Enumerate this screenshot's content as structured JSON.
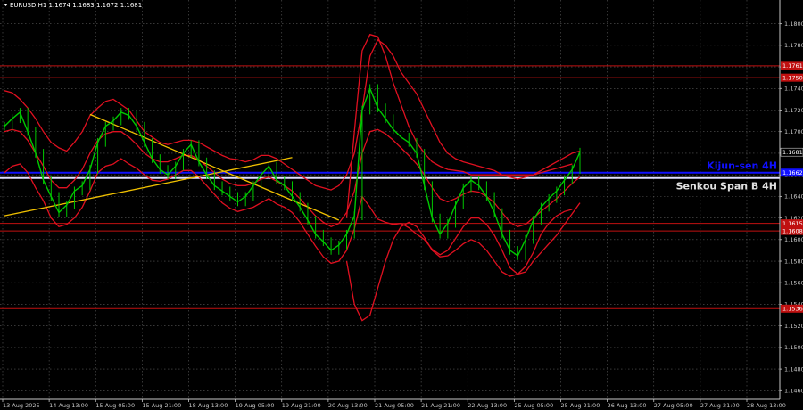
{
  "header": {
    "symbol_line": "EURUSD,H1  1.1674 1.1683 1.1672 1.1681"
  },
  "colors": {
    "background": "#000000",
    "grid": "#5a5a5a",
    "bull": "#00c800",
    "bear": "#00c800",
    "kumo": "#e01020",
    "trendline": "#f0c000",
    "level_red": "#c01010",
    "kijun": "#1010ff",
    "senkou": "#e0e0ff",
    "price_line": "#7a7a7a",
    "tick_text": "#c8c8c8"
  },
  "chart_data": {
    "type": "line",
    "title": "",
    "xlabel": "",
    "ylabel": "",
    "ylim": [
      1.1452,
      1.1822
    ],
    "y_ticks": [
      "1.1800",
      "1.1780",
      "1.1760",
      "1.1740",
      "1.1720",
      "1.1700",
      "1.1680",
      "1.1660",
      "1.1640",
      "1.1620",
      "1.1600",
      "1.1580",
      "1.1560",
      "1.1540",
      "1.1520",
      "1.1500",
      "1.1480",
      "1.1460"
    ],
    "x_ticks": [
      "13 Aug 2025",
      "14 Aug 13:00",
      "15 Aug 05:00",
      "15 Aug 21:00",
      "18 Aug 13:00",
      "19 Aug 05:00",
      "19 Aug 21:00",
      "20 Aug 13:00",
      "21 Aug 05:00",
      "21 Aug 21:00",
      "22 Aug 13:00",
      "25 Aug 05:00",
      "25 Aug 21:00",
      "26 Aug 13:00",
      "27 Aug 05:00",
      "27 Aug 21:00",
      "28 Aug 13:00"
    ],
    "grid": true,
    "series": [
      {
        "name": "",
        "role": "close",
        "color": "#00c800",
        "values": [
          1.1705,
          1.1712,
          1.1718,
          1.17,
          1.168,
          1.1655,
          1.164,
          1.1625,
          1.1632,
          1.1645,
          1.165,
          1.1665,
          1.169,
          1.1705,
          1.171,
          1.1718,
          1.1715,
          1.1705,
          1.169,
          1.1675,
          1.1665,
          1.166,
          1.1668,
          1.168,
          1.1688,
          1.1672,
          1.166,
          1.165,
          1.1645,
          1.164,
          1.1635,
          1.164,
          1.165,
          1.166,
          1.1668,
          1.1655,
          1.165,
          1.164,
          1.163,
          1.1618,
          1.1605,
          1.1598,
          1.159,
          1.1595,
          1.1605,
          1.1622,
          1.172,
          1.174,
          1.1722,
          1.1712,
          1.1702,
          1.1695,
          1.169,
          1.168,
          1.165,
          1.162,
          1.1605,
          1.1615,
          1.1632,
          1.1648,
          1.1655,
          1.165,
          1.164,
          1.1625,
          1.1605,
          1.159,
          1.1585,
          1.16,
          1.1618,
          1.163,
          1.1638,
          1.1645,
          1.1655,
          1.1665,
          1.1681
        ]
      },
      {
        "name": "",
        "role": "band-upper",
        "color": "#e01020",
        "values": [
          1.1738,
          1.1736,
          1.173,
          1.1722,
          1.1712,
          1.17,
          1.169,
          1.1685,
          1.1682,
          1.169,
          1.17,
          1.1715,
          1.1722,
          1.1728,
          1.173,
          1.1725,
          1.172,
          1.171,
          1.17,
          1.1695,
          1.169,
          1.1688,
          1.169,
          1.1692,
          1.1692,
          1.169,
          1.1686,
          1.1682,
          1.1678,
          1.1675,
          1.1674,
          1.1672,
          1.1674,
          1.1678,
          1.1678,
          1.1675,
          1.167,
          1.1665,
          1.166,
          1.1655,
          1.165,
          1.1648,
          1.1646,
          1.165,
          1.166,
          1.168,
          1.172,
          1.177,
          1.1785,
          1.178,
          1.177,
          1.1755,
          1.1745,
          1.1735,
          1.172,
          1.1705,
          1.169,
          1.168,
          1.1675,
          1.1672,
          1.167,
          1.1668,
          1.1666,
          1.1664,
          1.166,
          1.1658,
          1.1656,
          1.1658,
          1.166,
          1.1664,
          1.1668,
          1.1672,
          1.1676,
          1.168,
          1.1682
        ]
      },
      {
        "name": "",
        "role": "band-middle",
        "color": "#e01020",
        "values": [
          1.17,
          1.1702,
          1.17,
          1.1692,
          1.168,
          1.1668,
          1.1655,
          1.1648,
          1.1648,
          1.1655,
          1.1665,
          1.168,
          1.1692,
          1.1698,
          1.17,
          1.17,
          1.1695,
          1.1688,
          1.168,
          1.1675,
          1.1672,
          1.1672,
          1.1675,
          1.1678,
          1.1678,
          1.1674,
          1.1668,
          1.1662,
          1.1656,
          1.1652,
          1.165,
          1.165,
          1.1652,
          1.1656,
          1.1658,
          1.1654,
          1.165,
          1.1645,
          1.1638,
          1.163,
          1.1622,
          1.1616,
          1.1612,
          1.1615,
          1.1625,
          1.1645,
          1.168,
          1.17,
          1.1702,
          1.1698,
          1.1692,
          1.1685,
          1.1678,
          1.167,
          1.166,
          1.1648,
          1.1638,
          1.1635,
          1.1638,
          1.1642,
          1.1645,
          1.1644,
          1.164,
          1.1634,
          1.1625,
          1.1616,
          1.1612,
          1.1614,
          1.162,
          1.1626,
          1.1632,
          1.1638,
          1.1645,
          1.1652,
          1.1658
        ]
      },
      {
        "name": "",
        "role": "band-lower",
        "color": "#e01020",
        "values": [
          1.1662,
          1.1668,
          1.167,
          1.1662,
          1.1648,
          1.1636,
          1.162,
          1.1612,
          1.1614,
          1.162,
          1.163,
          1.1645,
          1.1662,
          1.1668,
          1.167,
          1.1675,
          1.167,
          1.1666,
          1.166,
          1.1655,
          1.1654,
          1.1656,
          1.166,
          1.1664,
          1.1664,
          1.1658,
          1.165,
          1.1642,
          1.1634,
          1.1629,
          1.1626,
          1.1628,
          1.163,
          1.1634,
          1.1638,
          1.1633,
          1.163,
          1.1625,
          1.1616,
          1.1605,
          1.1594,
          1.1584,
          1.1578,
          1.158,
          1.159,
          1.161,
          1.164,
          1.163,
          1.1619,
          1.1616,
          1.1614,
          1.1615,
          1.1611,
          1.1605,
          1.16,
          1.1591,
          1.1586,
          1.159,
          1.1601,
          1.1612,
          1.162,
          1.162,
          1.1614,
          1.1604,
          1.159,
          1.1574,
          1.1568,
          1.157,
          1.158,
          1.1588,
          1.1596,
          1.1604,
          1.1614,
          1.1624,
          1.1634
        ]
      },
      {
        "name": "",
        "role": "channel-upper",
        "color": "#e01020",
        "values": [
          null,
          null,
          null,
          null,
          null,
          null,
          null,
          null,
          null,
          null,
          null,
          null,
          null,
          null,
          null,
          null,
          null,
          null,
          null,
          null,
          null,
          null,
          null,
          null,
          null,
          null,
          null,
          null,
          null,
          null,
          null,
          null,
          null,
          null,
          null,
          null,
          null,
          null,
          null,
          null,
          null,
          null,
          null,
          null,
          1.162,
          1.17,
          1.1775,
          1.179,
          1.1788,
          1.177,
          1.1745,
          1.1725,
          1.1705,
          1.169,
          1.168,
          1.1672,
          1.1668,
          1.1665,
          1.1664,
          1.1663,
          1.166,
          1.166,
          1.166,
          1.166,
          1.166,
          1.166,
          1.166,
          1.166,
          1.166,
          1.1662,
          1.1664,
          1.1666,
          1.1668,
          1.167,
          null
        ]
      },
      {
        "name": "",
        "role": "channel-lower",
        "color": "#e01020",
        "values": [
          null,
          null,
          null,
          null,
          null,
          null,
          null,
          null,
          null,
          null,
          null,
          null,
          null,
          null,
          null,
          null,
          null,
          null,
          null,
          null,
          null,
          null,
          null,
          null,
          null,
          null,
          null,
          null,
          null,
          null,
          null,
          null,
          null,
          null,
          null,
          null,
          null,
          null,
          null,
          null,
          null,
          null,
          null,
          null,
          1.158,
          1.154,
          1.1525,
          1.153,
          1.1555,
          1.158,
          1.16,
          1.1612,
          1.1616,
          1.1612,
          1.1602,
          1.159,
          1.1584,
          1.1585,
          1.159,
          1.1596,
          1.16,
          1.1597,
          1.159,
          1.158,
          1.157,
          1.1566,
          1.1568,
          1.1575,
          1.1588,
          1.1605,
          1.1615,
          1.1622,
          1.1626,
          1.1628,
          null
        ]
      }
    ],
    "trendlines": [
      {
        "from": [
          0,
          1.1622
        ],
        "to": [
          37,
          1.1676
        ]
      },
      {
        "from": [
          11,
          1.1716
        ],
        "to": [
          43,
          1.1618
        ]
      }
    ],
    "levels": [
      {
        "value": 1.1761,
        "label": "1.1761",
        "color": "#c01010"
      },
      {
        "value": 1.175,
        "label": "1.1750",
        "color": "#c01010"
      },
      {
        "value": 1.1662,
        "label": "1.1662",
        "color": "#1010ff"
      },
      {
        "value": 1.1657,
        "label": "",
        "color": "#e0e0ff"
      },
      {
        "value": 1.1615,
        "label": "1.1615",
        "color": "#c01010"
      },
      {
        "value": 1.1608,
        "label": "1.1608",
        "color": "#c01010"
      },
      {
        "value": 1.1536,
        "label": "1.1536",
        "color": "#c01010"
      }
    ],
    "current_price": {
      "value": 1.1681,
      "label": "1.1681"
    },
    "annotations": [
      {
        "text": "Kijun-sen 4H",
        "color": "#1010ff",
        "value": 1.1669
      },
      {
        "text": "Senkou Span B 4H",
        "color": "#e0e0e0",
        "value": 1.165
      }
    ]
  }
}
